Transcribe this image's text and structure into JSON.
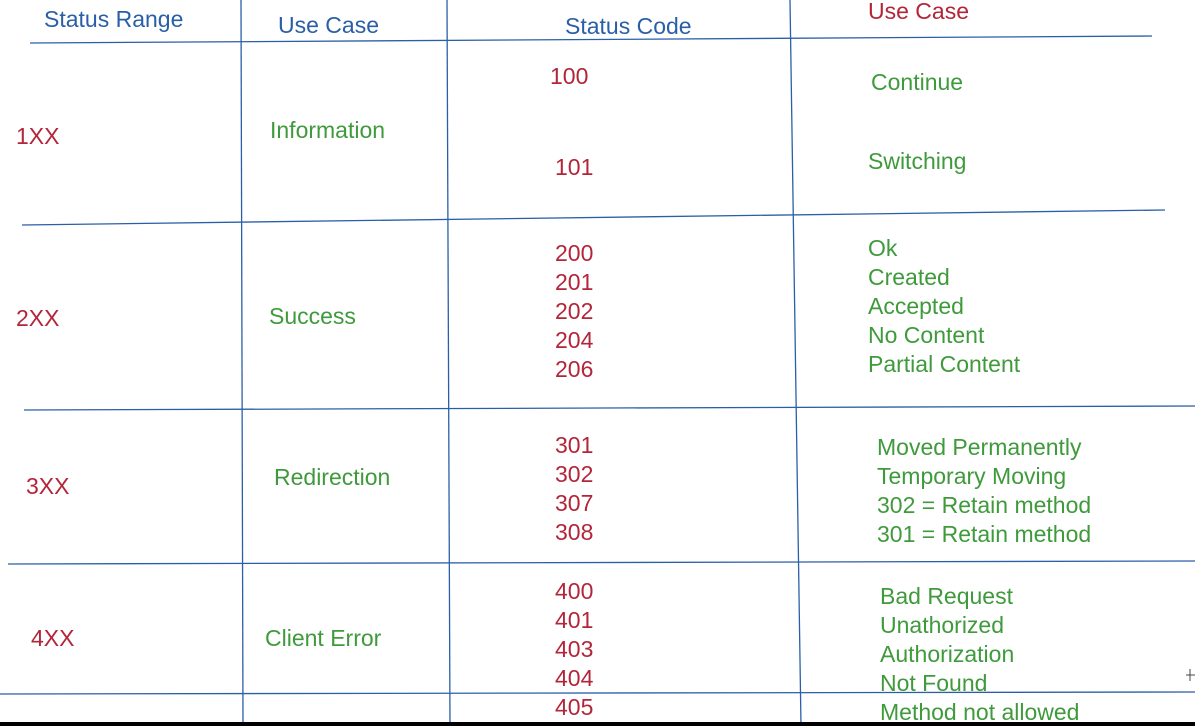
{
  "headers": {
    "status_range": "Status Range",
    "use_case": "Use Case",
    "status_code": "Status Code",
    "use_case_detail": "Use Case"
  },
  "rows": [
    {
      "range": "1XX",
      "category": "Information",
      "codes": [
        "100",
        "101"
      ],
      "meanings": [
        "Continue",
        "Switching"
      ]
    },
    {
      "range": "2XX",
      "category": "Success",
      "codes": [
        "200",
        "201",
        "202",
        "204",
        "206"
      ],
      "meanings": [
        "Ok",
        "Created",
        "Accepted",
        "No Content",
        "Partial Content"
      ]
    },
    {
      "range": "3XX",
      "category": "Redirection",
      "codes": [
        "301",
        "302",
        "307",
        "308"
      ],
      "meanings": [
        "Moved Permanently",
        "Temporary Moving",
        "302 = Retain method",
        "301 = Retain method"
      ]
    },
    {
      "range": "4XX",
      "category": "Client Error",
      "codes": [
        "400",
        "401",
        "403",
        "404",
        "405"
      ],
      "meanings": [
        "Bad Request",
        "Unathorized",
        "Authorization",
        "Not Found",
        "Method not allowed"
      ]
    }
  ],
  "colors": {
    "header": "#2a5fa8",
    "code": "#b3263a",
    "meaning": "#3f9a3c",
    "grid": "#2a5fa8"
  }
}
